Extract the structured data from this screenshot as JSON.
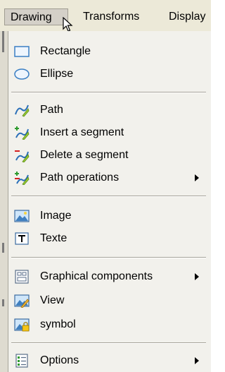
{
  "menubar": {
    "items": [
      {
        "label": "Drawing"
      },
      {
        "label": "Transforms"
      },
      {
        "label": "Display"
      }
    ]
  },
  "menu": {
    "items": [
      {
        "label": "Rectangle",
        "icon": "rectangle-icon"
      },
      {
        "label": "Ellipse",
        "icon": "ellipse-icon"
      },
      {
        "label": "Path",
        "icon": "path-icon"
      },
      {
        "label": "Insert a segment",
        "icon": "insert-segment-icon"
      },
      {
        "label": "Delete a segment",
        "icon": "delete-segment-icon"
      },
      {
        "label": "Path operations",
        "icon": "path-operations-icon",
        "submenu": true
      },
      {
        "label": "Image",
        "icon": "image-icon"
      },
      {
        "label": "Texte",
        "icon": "text-icon"
      },
      {
        "label": "Graphical components",
        "icon": "graphical-components-icon",
        "submenu": true
      },
      {
        "label": "View",
        "icon": "view-icon"
      },
      {
        "label": "symbol",
        "icon": "symbol-icon"
      },
      {
        "label": "Options",
        "icon": "options-icon",
        "submenu": true
      }
    ]
  },
  "colors": {
    "menubar_bg": "#ece9d8",
    "menu_bg": "#f2f1ec",
    "active_item_bg": "#d4d0c8"
  }
}
